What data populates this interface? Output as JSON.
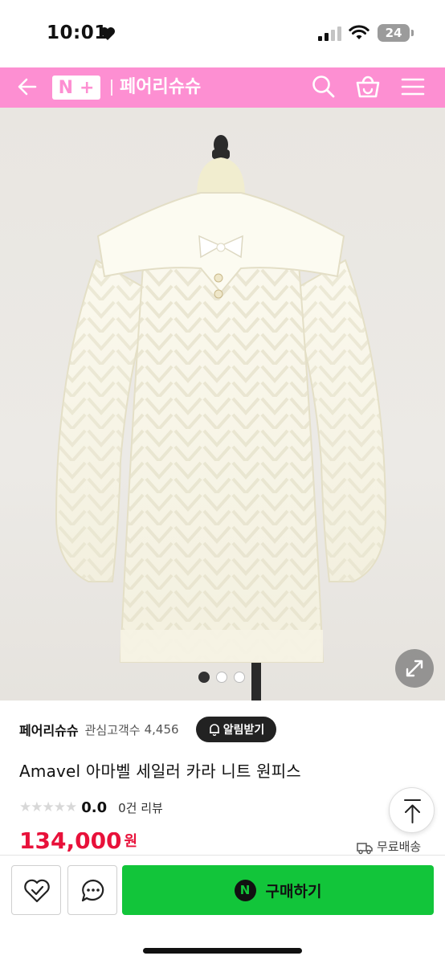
{
  "status_bar": {
    "time": "10:01",
    "battery": "24"
  },
  "header": {
    "badge": {
      "left": "N",
      "right": "+"
    },
    "store_name": "페어리슈슈",
    "brand_color": "#fd8fd2",
    "icons": [
      "back-arrow-icon",
      "search-icon",
      "shopping-bag-icon",
      "hamburger-menu-icon"
    ]
  },
  "gallery": {
    "image_description_hidden": false,
    "slide_total": 3,
    "slide_active": 1
  },
  "product": {
    "shop_name": "페어리슈슈",
    "fav_label": "관심고객수",
    "fav_count": "4,456",
    "alarm_label": "알림받기",
    "title": "Amavel 아마벨 세일러 카라 니트 원피스",
    "stars": "★★★★★",
    "rating": "0.0",
    "reviews": "0건 리뷰",
    "price": "134,000",
    "currency": "원",
    "shipping": "무료배송",
    "price_color": "#e8113a"
  },
  "bottom_bar": {
    "buy_label": "구매하기",
    "npay_letter": "N",
    "buy_color": "#12c53a"
  }
}
